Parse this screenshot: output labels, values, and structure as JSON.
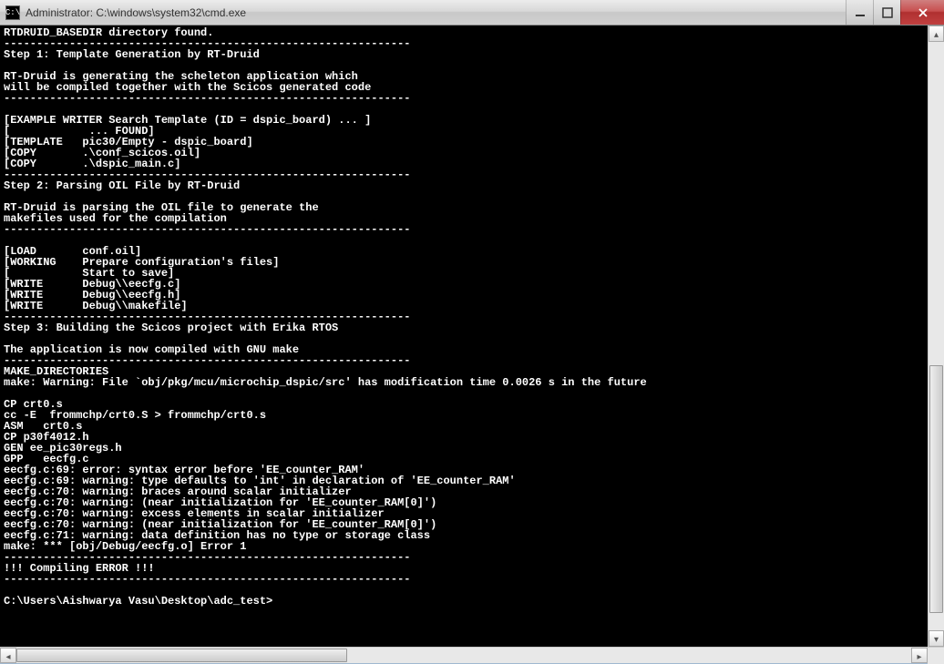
{
  "window": {
    "title": "Administrator: C:\\windows\\system32\\cmd.exe",
    "icon_label": "C:\\"
  },
  "console": {
    "lines": [
      "RTDRUID_BASEDIR directory found.",
      "--------------------------------------------------------------",
      "Step 1: Template Generation by RT-Druid",
      "",
      "RT-Druid is generating the scheleton application which",
      "will be compiled together with the Scicos generated code",
      "--------------------------------------------------------------",
      "",
      "[EXAMPLE WRITER Search Template (ID = dspic_board) ... ]",
      "[            ... FOUND]",
      "[TEMPLATE   pic30/Empty - dspic_board]",
      "[COPY       .\\conf_scicos.oil]",
      "[COPY       .\\dspic_main.c]",
      "--------------------------------------------------------------",
      "Step 2: Parsing OIL File by RT-Druid",
      "",
      "RT-Druid is parsing the OIL file to generate the",
      "makefiles used for the compilation",
      "--------------------------------------------------------------",
      "",
      "[LOAD       conf.oil]",
      "[WORKING    Prepare configuration's files]",
      "[           Start to save]",
      "[WRITE      Debug\\\\eecfg.c]",
      "[WRITE      Debug\\\\eecfg.h]",
      "[WRITE      Debug\\\\makefile]",
      "--------------------------------------------------------------",
      "Step 3: Building the Scicos project with Erika RTOS",
      "",
      "The application is now compiled with GNU make",
      "--------------------------------------------------------------",
      "MAKE_DIRECTORIES",
      "make: Warning: File `obj/pkg/mcu/microchip_dspic/src' has modification time 0.0026 s in the future",
      "",
      "CP crt0.s",
      "cc -E  frommchp/crt0.S > frommchp/crt0.s",
      "ASM   crt0.s",
      "CP p30f4012.h",
      "GEN ee_pic30regs.h",
      "GPP   eecfg.c",
      "eecfg.c:69: error: syntax error before 'EE_counter_RAM'",
      "eecfg.c:69: warning: type defaults to 'int' in declaration of 'EE_counter_RAM'",
      "eecfg.c:70: warning: braces around scalar initializer",
      "eecfg.c:70: warning: (near initialization for 'EE_counter_RAM[0]')",
      "eecfg.c:70: warning: excess elements in scalar initializer",
      "eecfg.c:70: warning: (near initialization for 'EE_counter_RAM[0]')",
      "eecfg.c:71: warning: data definition has no type or storage class",
      "make: *** [obj/Debug/eecfg.o] Error 1",
      "--------------------------------------------------------------",
      "!!! Compiling ERROR !!!",
      "--------------------------------------------------------------",
      "",
      "C:\\Users\\Aishwarya Vasu\\Desktop\\adc_test>"
    ]
  }
}
